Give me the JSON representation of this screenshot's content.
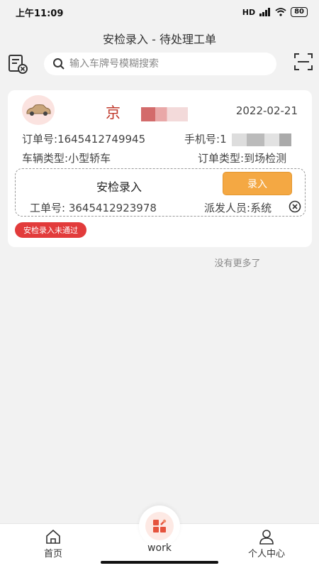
{
  "status_bar": {
    "time": "上午11:09",
    "network": "HD",
    "battery": "80"
  },
  "header": {
    "title": "安检录入 - 待处理工单"
  },
  "search": {
    "placeholder": "输入车牌号模糊搜索"
  },
  "order": {
    "plate": "京",
    "date": "2022-02-21",
    "order_no_label": "订单号:",
    "order_no": "1645412749945",
    "phone_label": "手机号:",
    "phone": "1",
    "vehicle_type_label": "车辆类型:",
    "vehicle_type": "小型轿车",
    "order_type_label": "订单类型:",
    "order_type": "到场检测",
    "task": {
      "title": "安检录入",
      "button": "录入",
      "work_no_label": "工单号:",
      "work_no": "3645412923978",
      "dispatcher_label": "派发人员:",
      "dispatcher": "系统"
    },
    "status_badge": "安检录入未通过"
  },
  "no_more": "没有更多了",
  "tabbar": {
    "home": "首页",
    "work": "work",
    "profile": "个人中心"
  },
  "colors": {
    "accent": "#f4a843",
    "danger": "#e23b3b",
    "plate": "#c0392b"
  }
}
